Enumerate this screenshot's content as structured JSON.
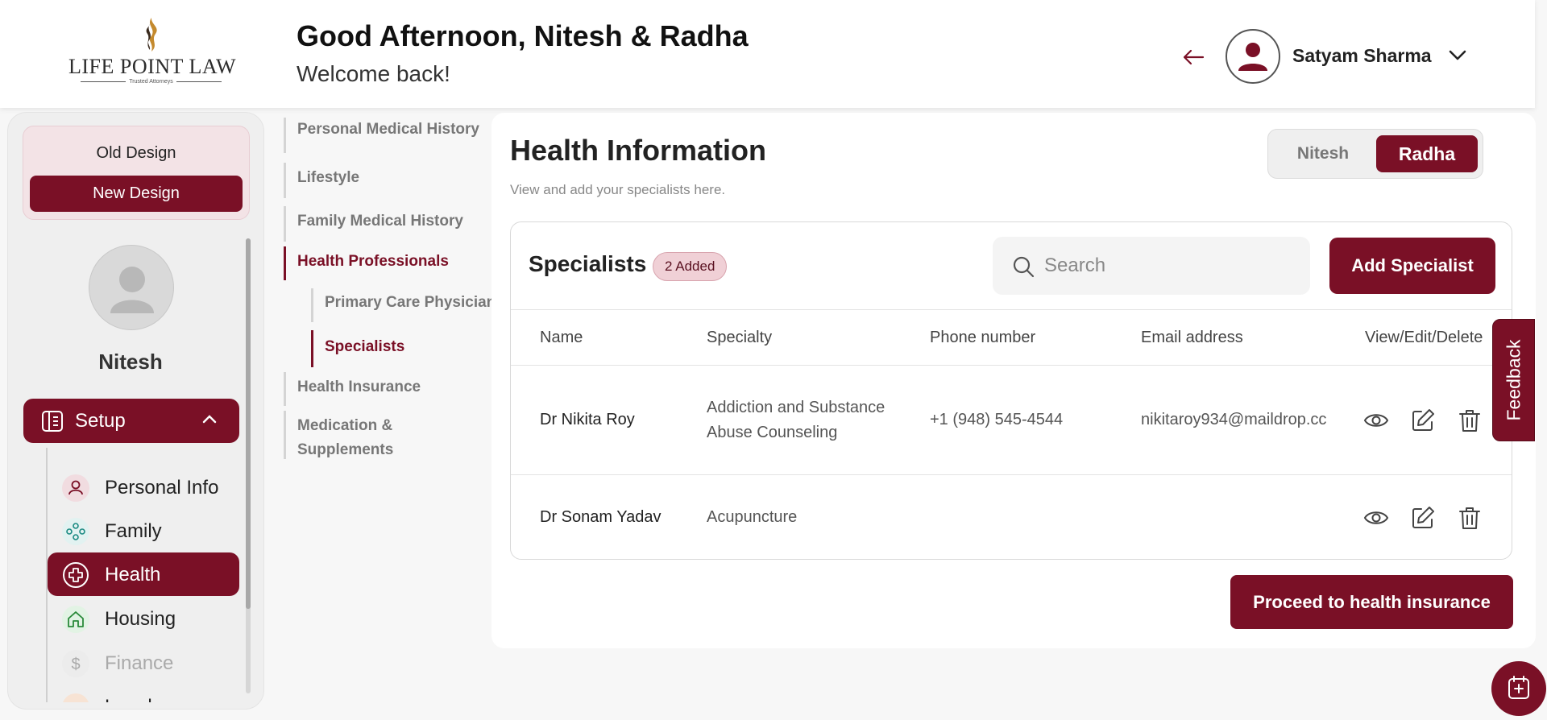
{
  "header": {
    "logo_text": "LIFE POINT LAW",
    "logo_tagline": "Trusted Attorneys",
    "greeting": "Good Afternoon, Nitesh & Radha",
    "welcome": "Welcome back!",
    "user_name": "Satyam Sharma"
  },
  "sidebar": {
    "old_design": "Old Design",
    "new_design": "New Design",
    "profile_name": "Nitesh",
    "setup_label": "Setup",
    "items": [
      {
        "label": "Personal Info",
        "icon": "user-icon"
      },
      {
        "label": "Family",
        "icon": "family-icon"
      },
      {
        "label": "Health",
        "icon": "health-cross-icon"
      },
      {
        "label": "Housing",
        "icon": "home-icon"
      },
      {
        "label": "Finance",
        "icon": "dollar-icon"
      },
      {
        "label": "Legal",
        "icon": "legal-icon"
      }
    ]
  },
  "subnav": {
    "personal_medical_history": "Personal Medical History",
    "lifestyle": "Lifestyle",
    "family_medical_history": "Family Medical History",
    "health_professionals": "Health Professionals",
    "primary_care_physician": "Primary Care Physician",
    "specialists": "Specialists",
    "health_insurance": "Health Insurance",
    "medication_line1": "Medication &",
    "medication_line2": "Supplements"
  },
  "main": {
    "title": "Health Information",
    "subtitle": "View and add your specialists here.",
    "toggle": [
      "Nitesh",
      "Radha"
    ],
    "card_title": "Specialists",
    "badge": "2 Added",
    "search_placeholder": "Search",
    "add_button": "Add Specialist",
    "columns": [
      "Name",
      "Specialty",
      "Phone number",
      "Email address",
      "View/Edit/Delete"
    ],
    "rows": [
      {
        "name": "Dr Nikita Roy",
        "specialty_line1": "Addiction and Substance",
        "specialty_line2": "Abuse Counseling",
        "phone": "+1 (948) 545-4544",
        "email": "nikitaroy934@maildrop.cc"
      },
      {
        "name": "Dr Sonam Yadav",
        "specialty_line1": "Acupuncture",
        "specialty_line2": "",
        "phone": "",
        "email": ""
      }
    ],
    "proceed_button": "Proceed to health insurance"
  },
  "feedback": "Feedback",
  "colors": {
    "brand": "#7a1026",
    "badge_bg": "#f0d0d6"
  }
}
